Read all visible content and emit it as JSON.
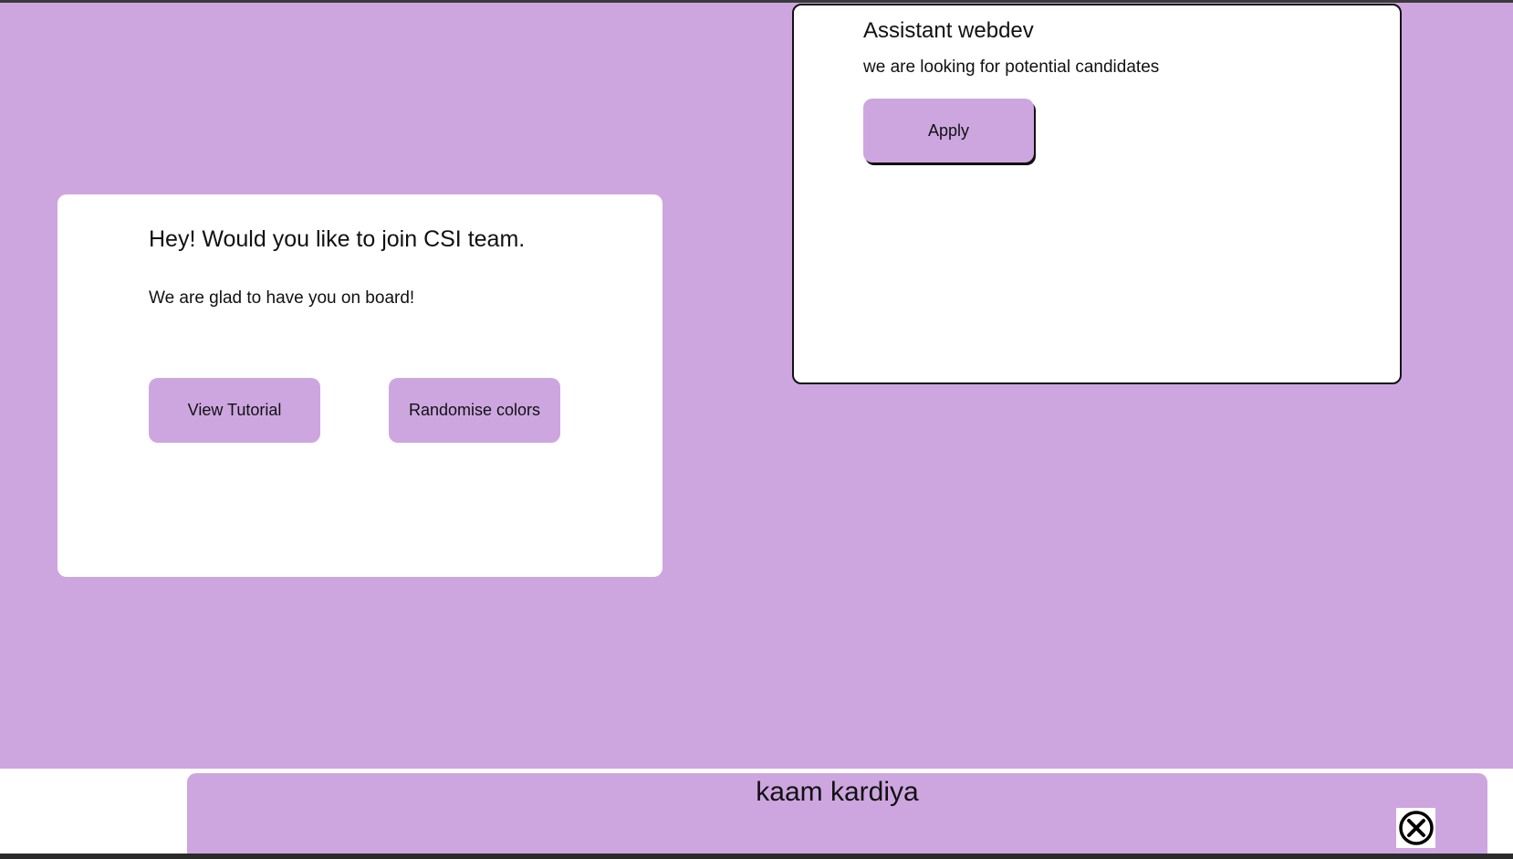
{
  "colors": {
    "background": "#cda6e0",
    "card": "#ffffff",
    "button": "#cda6e0",
    "text": "#111111"
  },
  "join_card": {
    "title": "Hey! Would you like to join CSI team.",
    "subtitle": "We are glad to have you on board!",
    "tutorial_label": "View Tutorial",
    "randomise_label": "Randomise colors"
  },
  "job_card": {
    "title": "Assistant webdev",
    "description": "we are looking for potential candidates",
    "apply_label": "Apply"
  },
  "toast": {
    "message": "kaam kardiya",
    "close_icon": "close-circle-icon"
  }
}
